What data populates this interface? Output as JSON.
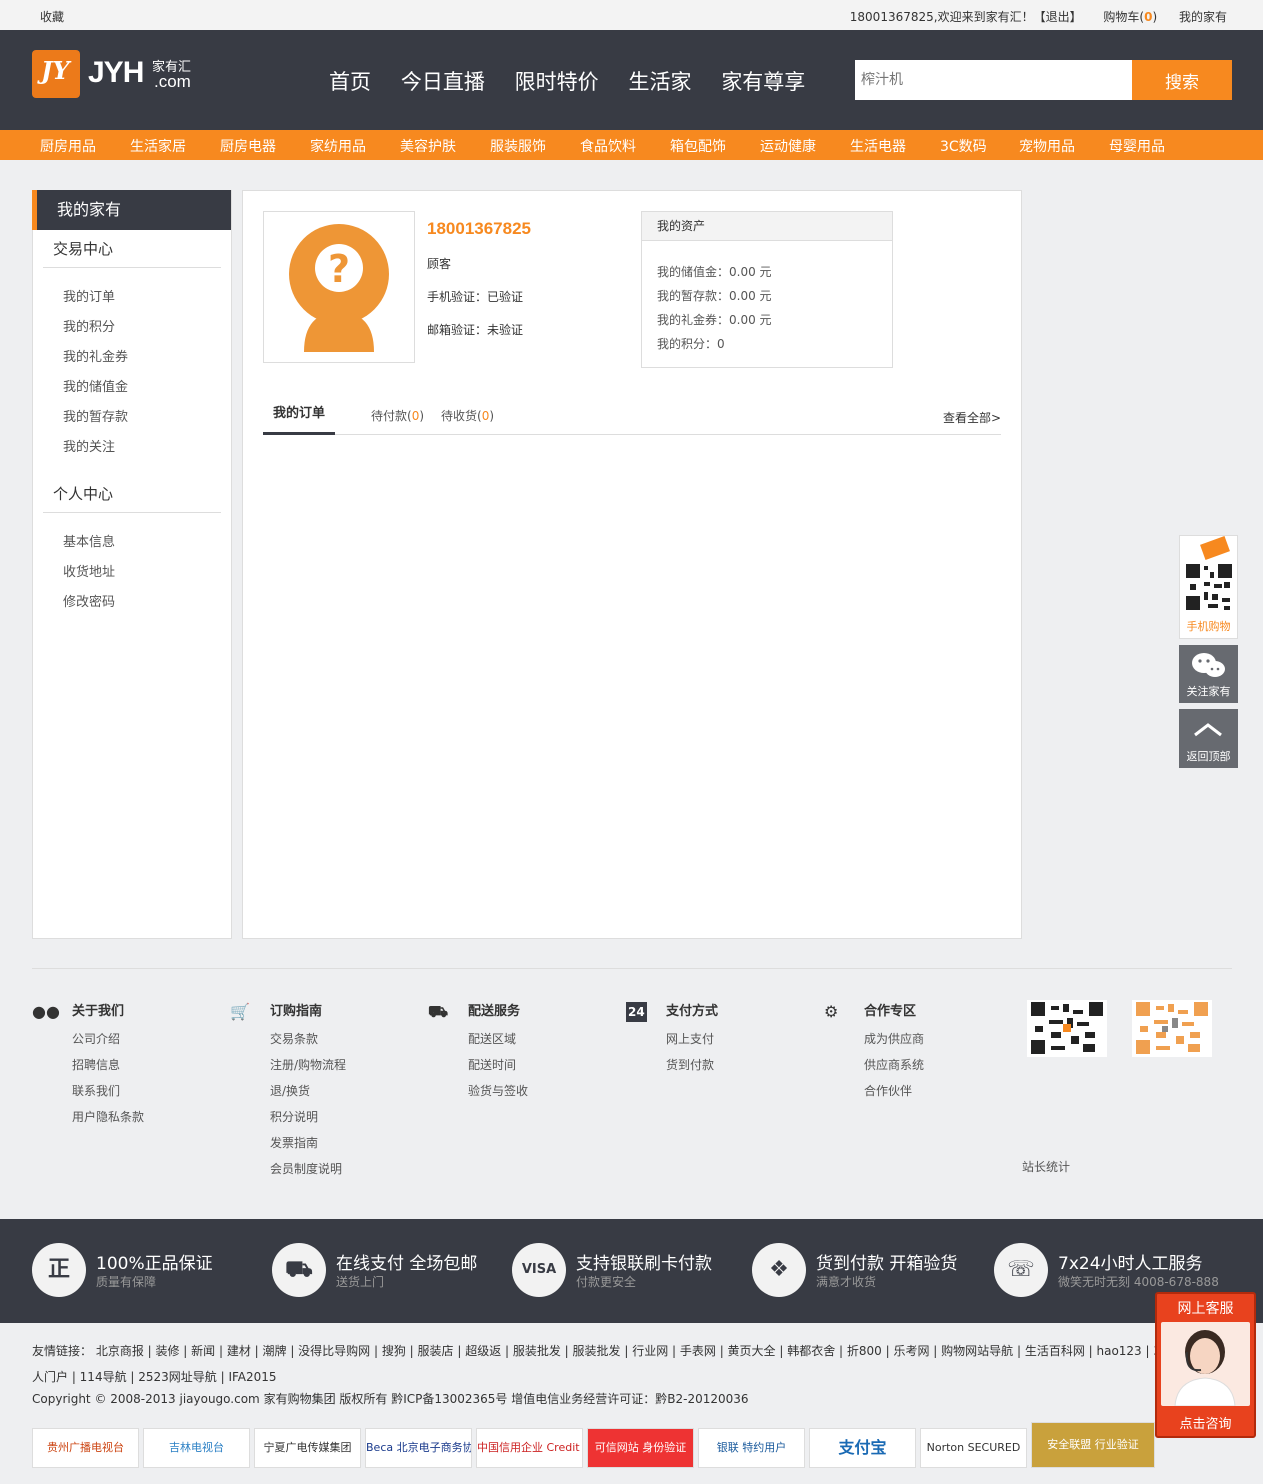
{
  "topbar": {
    "favorite": "收藏",
    "welcome": "18001367825,欢迎来到家有汇！【退出】",
    "cart_label": "购物车(",
    "cart_count": "0",
    "cart_close": ")",
    "my_home": "我的家有"
  },
  "logo": {
    "text": "JYH",
    "cn": "家有汇",
    "com": ".com"
  },
  "main_nav": [
    "首页",
    "今日直播",
    "限时特价",
    "生活家",
    "家有尊享"
  ],
  "search": {
    "placeholder": "榨汁机",
    "button": "搜索"
  },
  "categories": [
    "厨房用品",
    "生活家居",
    "厨房电器",
    "家纺用品",
    "美容护肤",
    "服装服饰",
    "食品饮料",
    "箱包配饰",
    "运动健康",
    "生活电器",
    "3C数码",
    "宠物用品",
    "母婴用品"
  ],
  "sidebar": {
    "title": "我的家有",
    "trade_title": "交易中心",
    "trade_items": [
      "我的订单",
      "我的积分",
      "我的礼金券",
      "我的储值金",
      "我的暂存款",
      "我的关注"
    ],
    "personal_title": "个人中心",
    "personal_items": [
      "基本信息",
      "收货地址",
      "修改密码"
    ]
  },
  "user": {
    "phone": "18001367825",
    "level": "顾客",
    "phone_verify": "手机验证：已验证",
    "email_verify": "邮箱验证：未验证"
  },
  "assets": {
    "title": "我的资产",
    "items": [
      "我的储值金：0.00 元",
      "我的暂存款：0.00 元",
      "我的礼金券：0.00 元",
      "我的积分：0"
    ]
  },
  "orders": {
    "tab_active": "我的订单",
    "tab_pending_pay": "待付款",
    "pending_pay_count": "0",
    "tab_pending_receive": "待收货",
    "pending_receive_count": "0",
    "view_all": "查看全部>"
  },
  "float": {
    "mobile": "手机购物",
    "follow": "关注家有",
    "top": "返回顶部"
  },
  "footer_cols": [
    {
      "title": "关于我们",
      "items": [
        "公司介绍",
        "招聘信息",
        "联系我们",
        "用户隐私条款"
      ]
    },
    {
      "title": "订购指南",
      "items": [
        "交易条款",
        "注册/购物流程",
        "退/换货",
        "积分说明",
        "发票指南",
        "会员制度说明"
      ]
    },
    {
      "title": "配送服务",
      "items": [
        "配送区域",
        "配送时间",
        "验货与签收"
      ]
    },
    {
      "title": "支付方式",
      "items": [
        "网上支付",
        "货到付款"
      ]
    },
    {
      "title": "合作专区",
      "items": [
        "成为供应商",
        "供应商系统",
        "合作伙伴"
      ]
    }
  ],
  "stats": "站长统计",
  "promos": [
    {
      "icon": "正",
      "l1": "100%正品保证",
      "l2": "质量有保障"
    },
    {
      "icon": "⛟",
      "l1": "在线支付 全场包邮",
      "l2": "送货上门"
    },
    {
      "icon": "VISA",
      "l1": "支持银联刷卡付款",
      "l2": "付款更安全"
    },
    {
      "icon": "❖",
      "l1": "货到付款 开箱验货",
      "l2": "满意才收货"
    },
    {
      "icon": "☏",
      "l1": "7x24小时人工服务",
      "l2": "微笑无时无刻 4008-678-888"
    }
  ],
  "links": {
    "line1": "友情链接： 北京商报 | 装修 | 新闻 | 建材 | 潮牌 | 没得比导购网 | 搜狗 | 服装店 | 超级返 | 服装批发 | 服装批发 | 行业网 | 手表网 | 黄页大全 | 韩都衣舍 | 折800 | 乐考网 | 购物网站导航 | 生活百科网 | hao123 | 360",
    "line2": "人门户 | 114导航 | 2523网址导航 | IFA2015"
  },
  "copyright": "Copyright © 2008-2013 jiayougo.com 家有购物集团 版权所有 黔ICP备13002365号 增值电信业务经营许可证：黔B2-20120036",
  "badges": [
    "贵州广播电视台",
    "吉林电视台",
    "宁夏广电传媒集团",
    "Beca 北京电子商务协会",
    "中国信用企业 Credit Rating",
    "可信网站 身份验证",
    "银联 特约用户",
    "支付宝",
    "Norton SECURED",
    "安全联盟 行业验证"
  ],
  "kefu": {
    "title": "网上客服",
    "button": "点击咨询"
  },
  "colors": {
    "dark": "#383b44",
    "orange": "#f7891f",
    "bg": "#eeeff1"
  }
}
